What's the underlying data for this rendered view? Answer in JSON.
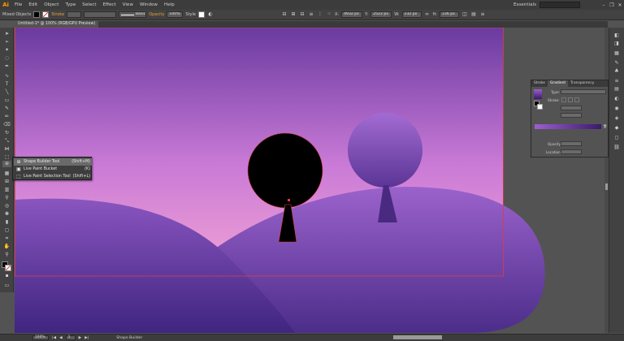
{
  "app": {
    "logo": "Ai"
  },
  "menu": [
    "File",
    "Edit",
    "Object",
    "Type",
    "Select",
    "Effect",
    "View",
    "Window",
    "Help"
  ],
  "essentials": "Essentials",
  "window_controls": [
    "–",
    "❐",
    "✕"
  ],
  "control_bar": {
    "selection_type": "Mixed Objects",
    "stroke_label": "Stroke",
    "brush": "Basic",
    "opacity_label": "Opacity",
    "opacity_value": "100%",
    "style_label": "Style",
    "x_label": "X:",
    "x_value": "4932 px",
    "y_label": "Y:",
    "y_value": "2522 px",
    "w_label": "W:",
    "w_value": "232 px",
    "h_label": "H:",
    "h_value": "236 px"
  },
  "document_tab": "Untitled-1* @ 100% (RGB/GPU Preview)",
  "flyout": {
    "items": [
      {
        "icon": "⊕",
        "label": "Shape Builder Tool",
        "shortcut": "(Shift+M)"
      },
      {
        "icon": "▣",
        "label": "Live Paint Bucket",
        "shortcut": "(K)"
      },
      {
        "icon": "⬚",
        "label": "Live Paint Selection Tool",
        "shortcut": "(Shift+L)"
      }
    ]
  },
  "gradient_panel": {
    "tabs": [
      "Stroke",
      "Gradient",
      "Transparency"
    ],
    "type_label": "Type:",
    "stroke_label": "Stroke:",
    "opacity_label": "Opacity:",
    "location_label": "Location:",
    "colors": {
      "start": "#9d5fd0",
      "end": "#3b1a6b"
    }
  },
  "status_bar": {
    "zoom": "100%",
    "page": "1",
    "tool": "Shape Builder"
  },
  "colors": {
    "sky_top": "#6a3aa0",
    "sky_bottom": "#f2a3d4",
    "hill_back": "#8a55c0",
    "hill_front": "#5a3596",
    "tree_trunk": "#4a2a80",
    "accent_orange": "#e6a23c",
    "selection_red": "#e03a4a"
  }
}
